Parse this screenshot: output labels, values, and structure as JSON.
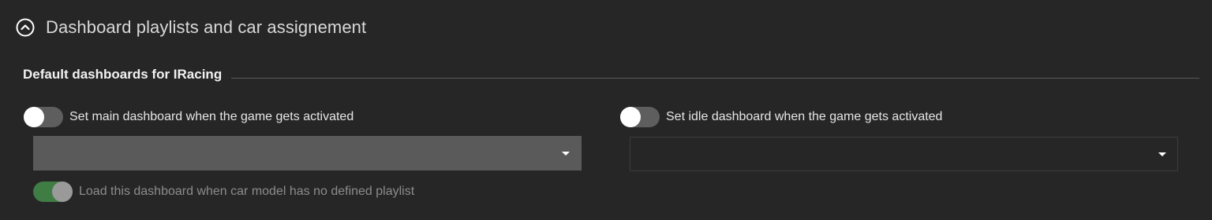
{
  "section": {
    "title": "Dashboard playlists and car assignement",
    "icon": "chevron-up-circle-icon"
  },
  "group": {
    "title": "Default dashboards for IRacing"
  },
  "main_dashboard": {
    "toggle_label": "Set main dashboard when the game gets activated",
    "toggle_on": false,
    "selected_value": "",
    "fallback_label": "Load this dashboard when car model has no defined playlist",
    "fallback_on": true
  },
  "idle_dashboard": {
    "toggle_label": "Set idle dashboard when the game gets activated",
    "toggle_on": false,
    "selected_value": ""
  },
  "colors": {
    "background": "#262626",
    "toggle_on_track": "#3f7d45",
    "toggle_off_track": "#5e5e5e",
    "select_filled": "#5a5a5a"
  }
}
